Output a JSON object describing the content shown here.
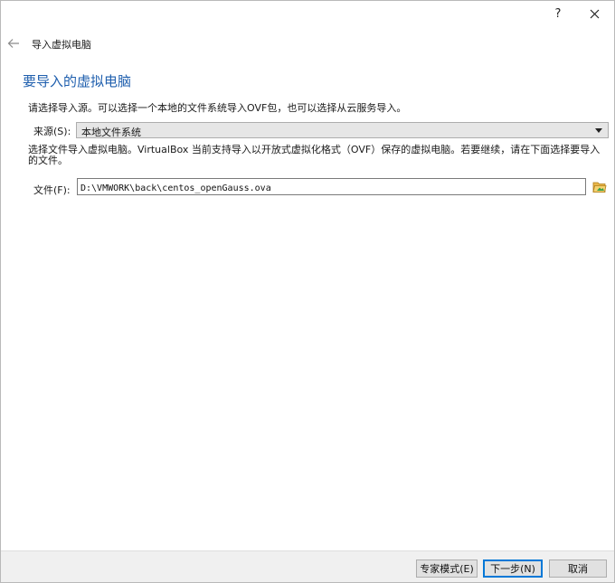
{
  "window": {
    "help_label": "?"
  },
  "nav": {
    "title": "导入虚拟电脑"
  },
  "page": {
    "heading": "要导入的虚拟电脑",
    "intro": "请选择导入源。可以选择一个本地的文件系统导入OVF包，也可以选择从云服务导入。",
    "description": "选择文件导入虚拟电脑。VirtualBox 当前支持导入以开放式虚拟化格式（OVF）保存的虚拟电脑。若要继续，请在下面选择要导入的文件。"
  },
  "source": {
    "label": "来源(S):",
    "selected": "本地文件系统"
  },
  "file": {
    "label": "文件(F):",
    "value": "D:\\VMWORK\\back\\centos_openGauss.ova"
  },
  "buttons": {
    "expert": "专家模式(E)",
    "next": "下一步(N)",
    "cancel": "取消"
  },
  "colors": {
    "heading": "#1f5fae",
    "primary_border": "#0078d7",
    "footer_bg": "#f0f0f0"
  },
  "icons": {
    "back": "arrow-left",
    "close": "x",
    "folder": "folder-open"
  }
}
